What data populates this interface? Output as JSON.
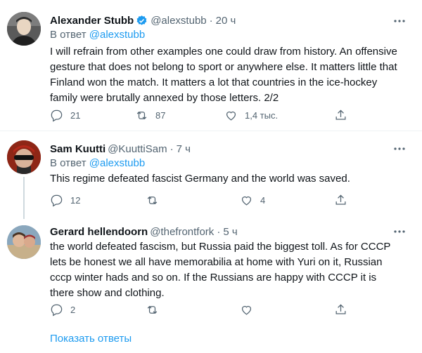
{
  "tweets": [
    {
      "name": "Alexander Stubb",
      "verified": true,
      "handle": "@alexstubb",
      "time": "20 ч",
      "reply_prefix": "В ответ",
      "reply_to": "@alexstubb",
      "text": "I will refrain from other examples one could draw from history. An offensive gesture that does not belong to sport or anywhere else. It matters little that Finland won the match. It matters a lot that countries in the ice-hockey family were brutally annexed by those letters. 2/2",
      "replies": "21",
      "retweets": "87",
      "likes": "1,4 тыс."
    },
    {
      "name": "Sam Kuutti",
      "handle": "@KuuttiSam",
      "time": "7 ч",
      "reply_prefix": "В ответ",
      "reply_to": "@alexstubb",
      "text": "This regime defeated fascist Germany and the world was saved.",
      "replies": "12",
      "retweets": "",
      "likes": "4"
    },
    {
      "name": "Gerard hellendoorn",
      "handle": "@thefrontfork",
      "time": "5 ч",
      "text": "the world defeated fascism, but Russia paid the biggest toll. As for CCCP lets be honest we all have memorabilia at home with Yuri on it, Russian cccp winter hads and so on. If the Russians are happy with CCCP it is there show and clothing.",
      "replies": "2",
      "retweets": "",
      "likes": ""
    }
  ],
  "separator": "·",
  "show_replies": "Показать ответы",
  "colors": {
    "accent": "#1d9bf0",
    "muted": "#536471",
    "text": "#0f1419",
    "divider": "#eff3f4"
  },
  "icons": [
    "verified-badge-icon",
    "more-icon",
    "reply-icon",
    "retweet-icon",
    "like-icon",
    "share-icon"
  ]
}
